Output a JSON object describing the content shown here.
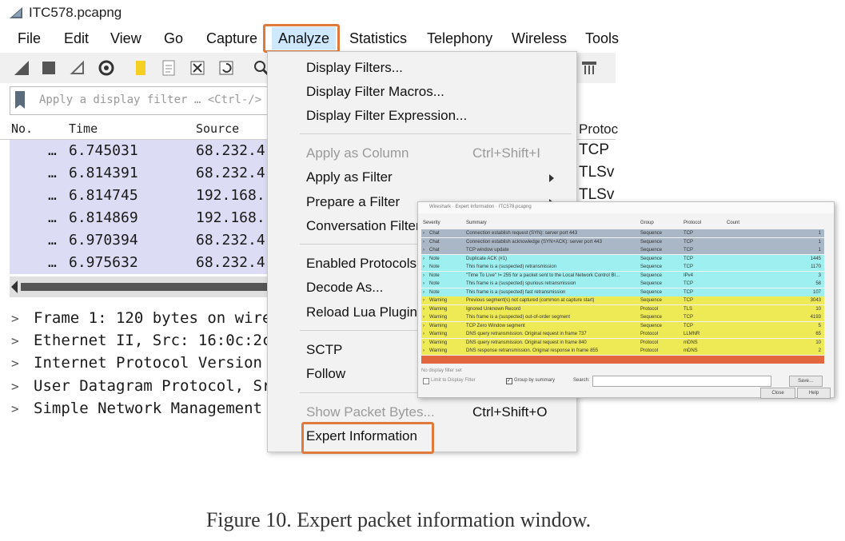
{
  "window": {
    "title": "ITC578.pcapng"
  },
  "menubar": {
    "items": [
      "File",
      "Edit",
      "View",
      "Go",
      "Capture",
      "Analyze",
      "Statistics",
      "Telephony",
      "Wireless",
      "Tools"
    ]
  },
  "filter": {
    "placeholder": "Apply a display filter … <Ctrl-/>"
  },
  "packet_list": {
    "columns": {
      "no": "No.",
      "time": "Time",
      "source": "Source",
      "protocol": "Protoc"
    },
    "rows": [
      {
        "no": "…",
        "time": "6.745031",
        "source": "68.232.4",
        "protocol": "TCP"
      },
      {
        "no": "…",
        "time": "6.814391",
        "source": "68.232.4",
        "protocol": "TLSv"
      },
      {
        "no": "…",
        "time": "6.814745",
        "source": "192.168.",
        "protocol": "TLSv"
      },
      {
        "no": "…",
        "time": "6.814869",
        "source": "192.168.",
        "protocol": ""
      },
      {
        "no": "…",
        "time": "6.970394",
        "source": "68.232.4",
        "protocol": ""
      },
      {
        "no": "…",
        "time": "6.975632",
        "source": "68.232.4",
        "protocol": ""
      }
    ]
  },
  "details": {
    "lines": [
      "Frame 1: 120 bytes on wire",
      "Ethernet II, Src: 16:0c:2c",
      "Internet Protocol Version",
      "User Datagram Protocol, Sr",
      "Simple Network Management"
    ]
  },
  "analyze_menu": {
    "display_filters": "Display Filters...",
    "display_filter_macros": "Display Filter Macros...",
    "display_filter_expression": "Display Filter Expression...",
    "apply_as_column": "Apply as Column",
    "apply_as_column_shortcut": "Ctrl+Shift+I",
    "apply_as_filter": "Apply as Filter",
    "prepare_a_filter": "Prepare a Filter",
    "conversation_filter": "Conversation Filter",
    "enabled_protocols": "Enabled Protocols.",
    "decode_as": "Decode As...",
    "reload_lua_plugins": "Reload Lua Plugins",
    "sctp": "SCTP",
    "follow": "Follow",
    "show_packet_bytes": "Show Packet Bytes...",
    "show_packet_bytes_shortcut": "Ctrl+Shift+O",
    "expert_information": "Expert Information"
  },
  "expert_window": {
    "title": "Wireshark · Expert Information · ITC578.pcapng",
    "columns": {
      "severity": "Severity",
      "summary": "Summary",
      "group": "Group",
      "protocol": "Protocol",
      "count": "Count"
    },
    "rows": [
      {
        "severity": "Chat",
        "summary": "Connection establish request (SYN): server port 443",
        "group": "Sequence",
        "protocol": "TCP",
        "count": "1",
        "color": "#a9b7c6"
      },
      {
        "severity": "Chat",
        "summary": "Connection establish acknowledge (SYN+ACK): server port 443",
        "group": "Sequence",
        "protocol": "TCP",
        "count": "1",
        "color": "#a9b7c6"
      },
      {
        "severity": "Chat",
        "summary": "TCP window update",
        "group": "Sequence",
        "protocol": "TCP",
        "count": "1",
        "color": "#a9b7c6"
      },
      {
        "severity": "Note",
        "summary": "Duplicate ACK (#1)",
        "group": "Sequence",
        "protocol": "TCP",
        "count": "1445",
        "color": "#9ef0f0"
      },
      {
        "severity": "Note",
        "summary": "This frame is a (suspected) retransmission",
        "group": "Sequence",
        "protocol": "TCP",
        "count": "1170",
        "color": "#9ef0f0"
      },
      {
        "severity": "Note",
        "summary": "\"Time To Live\" != 255 for a packet sent to the Local Network Control Bl…",
        "group": "Sequence",
        "protocol": "IPv4",
        "count": "3",
        "color": "#9ef0f0"
      },
      {
        "severity": "Note",
        "summary": "This frame is a (suspected) spurious retransmission",
        "group": "Sequence",
        "protocol": "TCP",
        "count": "58",
        "color": "#9ef0f0"
      },
      {
        "severity": "Note",
        "summary": "This frame is a (suspected) fast retransmission",
        "group": "Sequence",
        "protocol": "TCP",
        "count": "107",
        "color": "#9ef0f0"
      },
      {
        "severity": "Warning",
        "summary": "Previous segment(s) not captured (common at capture start)",
        "group": "Sequence",
        "protocol": "TCP",
        "count": "3043",
        "color": "#eeea56"
      },
      {
        "severity": "Warning",
        "summary": "Ignored Unknown Record",
        "group": "Protocol",
        "protocol": "TLS",
        "count": "10",
        "color": "#eeea56"
      },
      {
        "severity": "Warning",
        "summary": "This frame is a (suspected) out-of-order segment",
        "group": "Sequence",
        "protocol": "TCP",
        "count": "4193",
        "color": "#eeea56"
      },
      {
        "severity": "Warning",
        "summary": "TCP Zero Window segment",
        "group": "Sequence",
        "protocol": "TCP",
        "count": "5",
        "color": "#eeea56"
      },
      {
        "severity": "Warning",
        "summary": "DNS query retransmission. Original request in frame 737",
        "group": "Protocol",
        "protocol": "LLMNR",
        "count": "65",
        "color": "#eeea56"
      },
      {
        "severity": "Warning",
        "summary": "DNS query retransmission. Original request in frame 840",
        "group": "Protocol",
        "protocol": "mDNS",
        "count": "10",
        "color": "#eeea56"
      },
      {
        "severity": "Warning",
        "summary": "DNS response retransmission. Original response in frame 855",
        "group": "Protocol",
        "protocol": "mDNS",
        "count": "2",
        "color": "#eeea56"
      },
      {
        "severity": "",
        "summary": "",
        "group": "",
        "protocol": "",
        "count": "",
        "color": "#e2673f"
      }
    ],
    "status": "No display filter set",
    "limit_label": "Limit to Display Filter",
    "group_label": "Group by summary",
    "search_label": "Search:",
    "save_label": "Save…",
    "close_label": "Close",
    "help_label": "Help"
  },
  "caption": "Figure 10. Expert packet information window.",
  "colors": {
    "highlight_border": "#e07a3c",
    "row_bg": "#dcdcf4",
    "menu_hover": "#cde8ff"
  }
}
